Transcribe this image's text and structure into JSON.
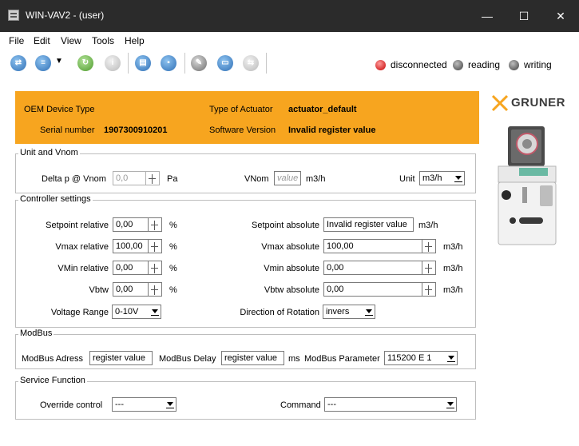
{
  "window": {
    "title": "WIN-VAV2 - (user)",
    "minimize_glyph": "—",
    "maximize_glyph": "☐",
    "close_glyph": "✕"
  },
  "menu": [
    "File",
    "Edit",
    "View",
    "Tools",
    "Help"
  ],
  "toolbar": {
    "icons": [
      "connect-icon",
      "open-dropdown-icon",
      "refresh-icon",
      "info-icon",
      "print-icon",
      "save-icon",
      "edit-icon",
      "folder-icon",
      "compare-icon"
    ],
    "dropdown_glyph": "▼"
  },
  "status": {
    "disconnected": "disconnected",
    "reading": "reading",
    "writing": "writing",
    "colors": {
      "disconnected": "#c40000",
      "reading": "#3e3e3e",
      "writing": "#3e3e3e"
    }
  },
  "header": {
    "oem_label": "OEM Device Type",
    "actuator_label": "Type of Actuator",
    "actuator_value": "actuator_default",
    "serial_label": "Serial number",
    "serial_value": "1907300910201",
    "software_label": "Software Version",
    "software_value": "Invalid register value",
    "background": "#f7a51f"
  },
  "brand": {
    "logo_text": "GRUNER"
  },
  "unit_vnom": {
    "title": "Unit and Vnom",
    "delta_p_label": "Delta p @ Vnom",
    "delta_p_value": "0,0",
    "delta_p_unit": "Pa",
    "vnom_label": "VNom",
    "vnom_placeholder": "value",
    "vnom_unit": "m3/h",
    "unit_label": "Unit",
    "unit_value": "m3/h"
  },
  "controller": {
    "title": "Controller settings",
    "setpoint_rel_label": "Setpoint relative",
    "setpoint_rel_value": "0,00",
    "vmax_rel_label": "Vmax relative",
    "vmax_rel_value": "100,00",
    "vmin_rel_label": "VMin relative",
    "vmin_rel_value": "0,00",
    "vbtw_label": "Vbtw",
    "vbtw_value": "0,00",
    "percent_unit": "%",
    "setpoint_abs_label": "Setpoint absolute",
    "setpoint_abs_value": "Invalid register value",
    "vmax_abs_label": "Vmax absolute",
    "vmax_abs_value": "100,00",
    "vmin_abs_label": "Vmin absolute",
    "vmin_abs_value": "0,00",
    "vbtw_abs_label": "Vbtw absolute",
    "vbtw_abs_value": "0,00",
    "flow_unit": "m3/h",
    "voltage_label": "Voltage Range",
    "voltage_value": "0-10V",
    "direction_label": "Direction of Rotation",
    "direction_value": "invers"
  },
  "modbus": {
    "title": "ModBus",
    "address_label": "ModBus Adress",
    "address_value": "register value",
    "delay_label": "ModBus Delay",
    "delay_value": "register value",
    "delay_unit": "ms",
    "parameter_label": "ModBus Parameter",
    "parameter_value": "115200 E 1"
  },
  "service": {
    "title": "Service Function",
    "override_label": "Override control",
    "override_value": "---",
    "command_label": "Command",
    "command_value": "---"
  }
}
